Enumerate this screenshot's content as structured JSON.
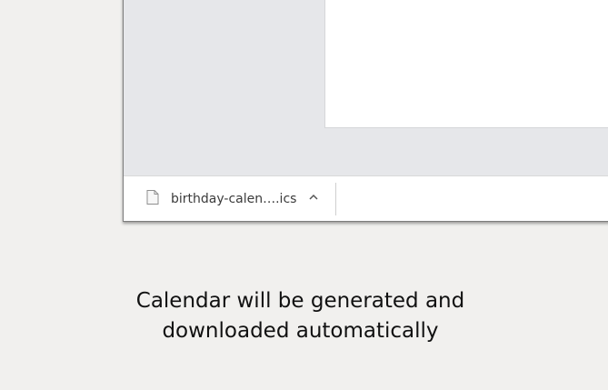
{
  "download_bar": {
    "file_name": "birthday-calen….ics",
    "file_icon": "document-icon",
    "menu_icon": "chevron-up-icon"
  },
  "caption": {
    "line1": "Calendar will be generated and",
    "line2": "downloaded automatically"
  },
  "colors": {
    "page_background": "#f1f0ee",
    "window_background": "#e6e7ea",
    "content_background": "#ffffff",
    "text": "#111111"
  }
}
